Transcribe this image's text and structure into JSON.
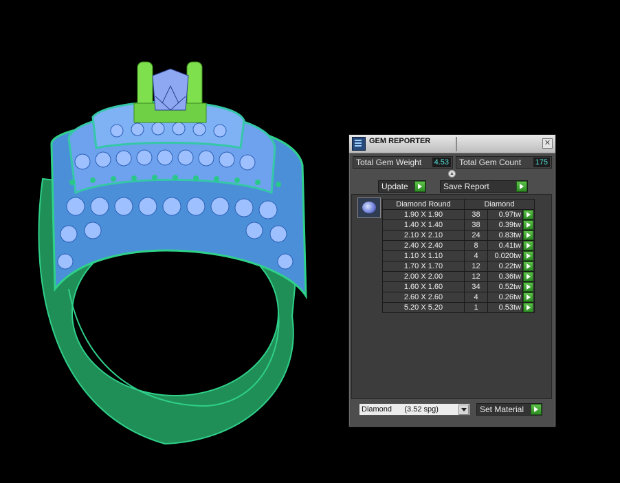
{
  "viewport": {
    "description_icon": "ring-3d-model"
  },
  "panel": {
    "title": "GEM REPORTER",
    "close_symbol": "✕",
    "total_weight_label": "Total Gem Weight",
    "total_weight_value": "4.53",
    "total_count_label": "Total Gem Count",
    "total_count_value": "175",
    "update_label": "Update",
    "save_report_label": "Save Report",
    "table": {
      "headers": [
        "Diamond Round",
        "Diamond"
      ],
      "rows": [
        {
          "size": "1.90 X 1.90",
          "count": "38",
          "weight": "0.97tw"
        },
        {
          "size": "1.40 X 1.40",
          "count": "38",
          "weight": "0.39tw"
        },
        {
          "size": "2.10 X 2.10",
          "count": "24",
          "weight": "0.83tw"
        },
        {
          "size": "2.40 X 2.40",
          "count": "8",
          "weight": "0.41tw"
        },
        {
          "size": "1.10 X 1.10",
          "count": "4",
          "weight": "0.020tw"
        },
        {
          "size": "1.70 X 1.70",
          "count": "12",
          "weight": "0.22tw"
        },
        {
          "size": "2.00 X 2.00",
          "count": "12",
          "weight": "0.36tw"
        },
        {
          "size": "1.60 X 1.60",
          "count": "34",
          "weight": "0.52tw"
        },
        {
          "size": "2.60 X 2.60",
          "count": "4",
          "weight": "0.26tw"
        },
        {
          "size": "5.20 X 5.20",
          "count": "1",
          "weight": "0.53tw"
        }
      ]
    },
    "material_select": "Diamond      (3.52 spg)",
    "set_material_label": "Set Material"
  },
  "colors": {
    "accent_green": "#3fa830",
    "value_cyan": "#55e6dd",
    "ring_green": "#1f9a5e",
    "gem_blue": "#8fb0f2"
  }
}
